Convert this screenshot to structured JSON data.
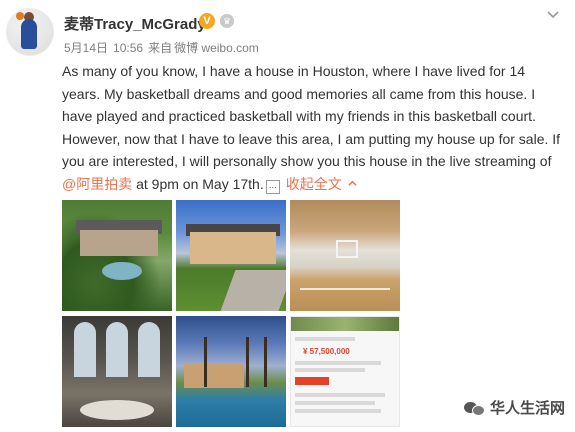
{
  "post": {
    "username": "麦蒂Tracy_McGrady",
    "verified_badge": "V",
    "crown_badge": "♛",
    "date": "5月14日",
    "time": "10:56",
    "source_prefix": "来自",
    "source": "微博 weibo.com",
    "text_before_mention": "As many of you know, I have a house in Houston, where I have  lived  for 14 years. My basketball dreams and good memories all came from this house. I have played and practiced basketball with my friends in this basketball court. However, now that I have to leave this area, I am putting my house up for sale. If you are interested, I will personally show you this house in the live streaming of ",
    "mention": "@阿里拍卖",
    "text_after_mention": " at 9pm on May 17th.",
    "more_button_icon": "…",
    "expand_label": "收起全文",
    "collapse_icon": "chevron-up-icon",
    "options_icon": "chevron-down-icon"
  },
  "photos": [
    {
      "subject": "aerial-mansion-photo"
    },
    {
      "subject": "mansion-front-photo"
    },
    {
      "subject": "basketball-court-photo"
    },
    {
      "subject": "living-room-photo"
    },
    {
      "subject": "pool-backyard-photo"
    },
    {
      "subject": "auction-listing-screenshot",
      "price": "¥ 57,500,000"
    }
  ],
  "watermark": {
    "label": "华人生活网",
    "icon": "wechat-icon"
  }
}
